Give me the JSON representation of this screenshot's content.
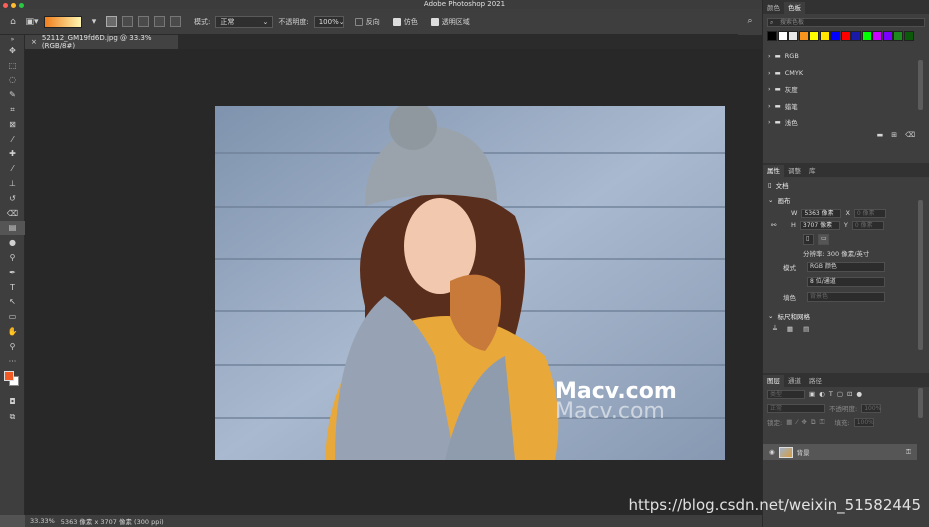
{
  "window": {
    "title": "Adobe Photoshop 2021"
  },
  "options": {
    "mode_label": "模式:",
    "mode_value": "正常",
    "opacity_label": "不透明度:",
    "opacity_value": "100%",
    "reverse_label": "反向",
    "dither_label": "仿色",
    "transparency_label": "透明区域"
  },
  "document": {
    "tab_title": "52112_GM19fd6D.jpg @ 33.3%(RGB/8#)",
    "watermark_1": "Macv.com",
    "watermark_2": "Macv.com"
  },
  "status": {
    "zoom": "33.33%",
    "info": "5363 像素 x 3707 像素 (300 ppi)"
  },
  "swatches_panel": {
    "tabs": [
      "颜色",
      "色板"
    ],
    "search_placeholder": "搜索色板",
    "colors": [
      "#000000",
      "#ffffff",
      "#e8e8e8",
      "#f7941d",
      "#ffff00",
      "#ffe600",
      "#0000ff",
      "#ff0000",
      "#1a1aa8",
      "#00ff00",
      "#cc00ff",
      "#7a00ff",
      "#1d8a1d",
      "#0a5a0a"
    ],
    "folders": [
      "RGB",
      "CMYK",
      "灰度",
      "蜡笔",
      "浅色"
    ]
  },
  "properties_panel": {
    "tabs": [
      "属性",
      "调整",
      "库"
    ],
    "doc_label": "文档",
    "canvas_section": "画布",
    "w_label": "W",
    "w_value": "5363 像素",
    "h_label": "H",
    "h_value": "3707 像素",
    "x_label": "X",
    "x_value": "0 像素",
    "y_label": "Y",
    "y_value": "0 像素",
    "resolution": "分辨率: 300 像素/英寸",
    "mode_label": "模式",
    "mode_value": "RGB 颜色",
    "depth_value": "8 位/通道",
    "fill_label": "填色",
    "fill_value": "背景色",
    "rulers_section": "标尺和网格"
  },
  "layers_panel": {
    "tabs": [
      "图层",
      "通道",
      "路径"
    ],
    "filter_placeholder": "类型",
    "blend_mode": "正常",
    "opacity_label": "不透明度:",
    "opacity_value": "100%",
    "lock_label": "锁定:",
    "fill_label": "填充:",
    "fill_value": "100%",
    "layer_name": "背景"
  },
  "overlay": {
    "csdn": "https://blog.csdn.net/weixin_51582445"
  }
}
